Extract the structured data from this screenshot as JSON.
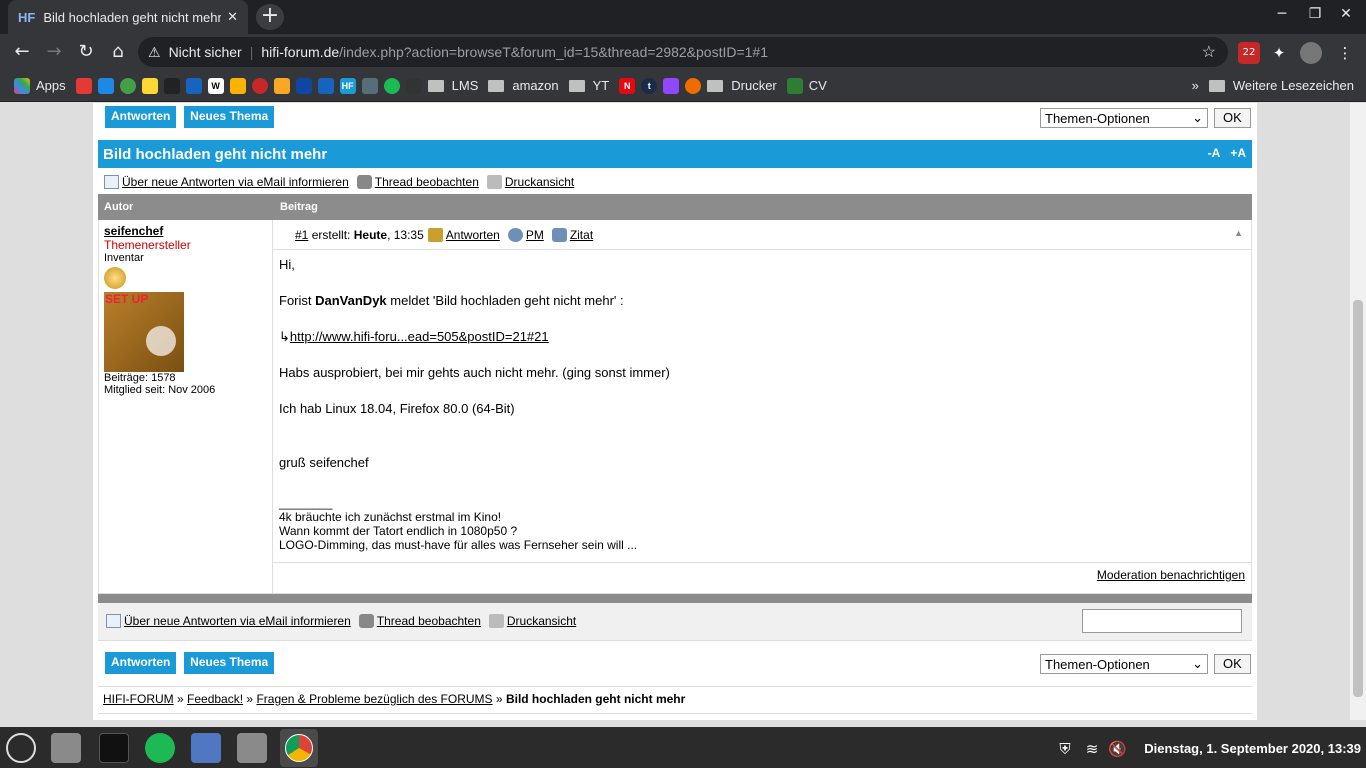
{
  "browser": {
    "tab_title": "Bild hochladen geht nicht mehr",
    "tab_favicon": "HF",
    "security_label": "Nicht sicher",
    "url_domain": "hifi-forum.de",
    "url_path": "/index.php?action=browseT&forum_id=15&thread=2982&postID=1#1",
    "ext_badge": "22",
    "bookmarks": [
      "Apps",
      "LMS",
      "amazon",
      "YT",
      "Drucker",
      "CV"
    ],
    "bookmark_more": "»",
    "other_bookmarks": "Weitere Lesezeichen"
  },
  "forum": {
    "reply_button": "Antworten",
    "new_thread_button": "Neues Thema",
    "options_select": "Themen-Optionen",
    "ok_button": "OK",
    "thread_title": "Bild hochladen geht nicht mehr",
    "font_minus": "-A",
    "font_plus": "+A",
    "email_notify": "Über neue Antworten via eMail informieren",
    "watch_thread": "Thread beobachten",
    "print_view": "Druckansicht",
    "col_author": "Autor",
    "col_post": "Beitrag"
  },
  "author": {
    "name": "seifenchef",
    "role": "Themenersteller",
    "rank": "Inventar",
    "avatar_text": "SET UP",
    "posts": "Beiträge: 1578",
    "member_since": "Mitglied seit: Nov 2006"
  },
  "post": {
    "number": "#1",
    "created_label": "erstellt:",
    "created_day": "Heute",
    "created_time": ", 13:35",
    "reply_link": "Antworten",
    "pm_link": "PM",
    "quote_link": "Zitat",
    "greeting": "Hi,",
    "line1_pre": "Forist ",
    "line1_user": "DanVanDyk",
    "line1_post": " meldet 'Bild hochladen geht nicht mehr' :",
    "link_arrow": "↳",
    "link": "http://www.hifi-foru...ead=505&postID=21#21",
    "line2": "Habs ausprobiert, bei mir gehts auch nicht mehr. (ging sonst immer)",
    "line3": "Ich hab Linux 18.04, Firefox 80.0 (64-Bit)",
    "closing": "gruß seifenchef",
    "sig_line": "________",
    "sig1": "4k bräuchte ich zunächst erstmal im Kino!",
    "sig2": "Wann kommt der Tatort endlich in 1080p50 ?",
    "sig3": "LOGO-Dimming, das must-have für alles was Fernseher sein will ...",
    "moderation": "Moderation benachrichtigen"
  },
  "breadcrumb": {
    "home": "HIFI-FORUM",
    "sep": "»",
    "level1": "Feedback!",
    "level2": "Fragen & Probleme bezüglich des FORUMS",
    "current": "Bild hochladen geht nicht mehr"
  },
  "taskbar": {
    "clock": "Dienstag,  1. September 2020, 13:39"
  },
  "colors": {
    "accent_blue": "#1a9ad6",
    "header_gray": "#8c8c8c",
    "role_red": "#d40000"
  }
}
